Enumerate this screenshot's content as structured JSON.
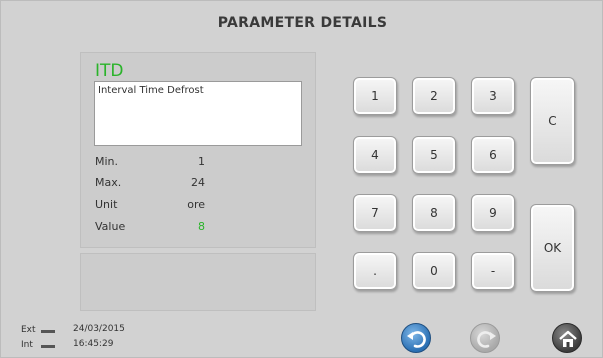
{
  "header": {
    "title": "PARAMETER DETAILS"
  },
  "parameter": {
    "code": "ITD",
    "description": "Interval Time Defrost",
    "min_label": "Min.",
    "min_value": "1",
    "max_label": "Max.",
    "max_value": "24",
    "unit_label": "Unit",
    "unit_value": "ore",
    "value_label": "Value",
    "value": "8"
  },
  "keypad": {
    "k1": "1",
    "k2": "2",
    "k3": "3",
    "k4": "4",
    "k5": "5",
    "k6": "6",
    "k7": "7",
    "k8": "8",
    "k9": "9",
    "dot": ".",
    "k0": "0",
    "minus": "-",
    "clear": "C",
    "ok": "OK"
  },
  "footer": {
    "ext_label": "Ext",
    "int_label": "Int",
    "date": "24/03/2015",
    "time": "16:45:29"
  },
  "nav": {
    "back_icon": "back-arrow-icon",
    "disabled_icon": "refresh-icon",
    "home_icon": "home-icon"
  },
  "colors": {
    "accent_green": "#2ab32a",
    "back_blue": "#2a6fb3"
  }
}
